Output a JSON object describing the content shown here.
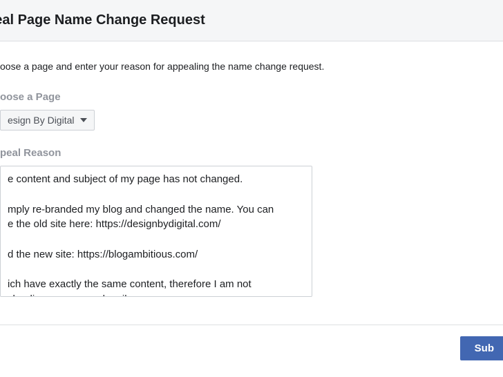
{
  "header": {
    "title": "peal Page Name Change Request"
  },
  "intro": "oose a page and enter your reason for appealing the name change request.",
  "choosePage": {
    "label": "oose a Page",
    "selected": "esign By Digital"
  },
  "appeal": {
    "label": "peal Reason",
    "text": "e content and subject of my page has not changed.\n\nmply re-branded my blog and changed the name. You can\ne the old site here: https://designbydigital.com/\n\nd the new site: https://blogambitious.com/\n\nich have exactly the same content, therefore I am not\nsleading my page subscribers."
  },
  "footer": {
    "submit": "Sub"
  }
}
